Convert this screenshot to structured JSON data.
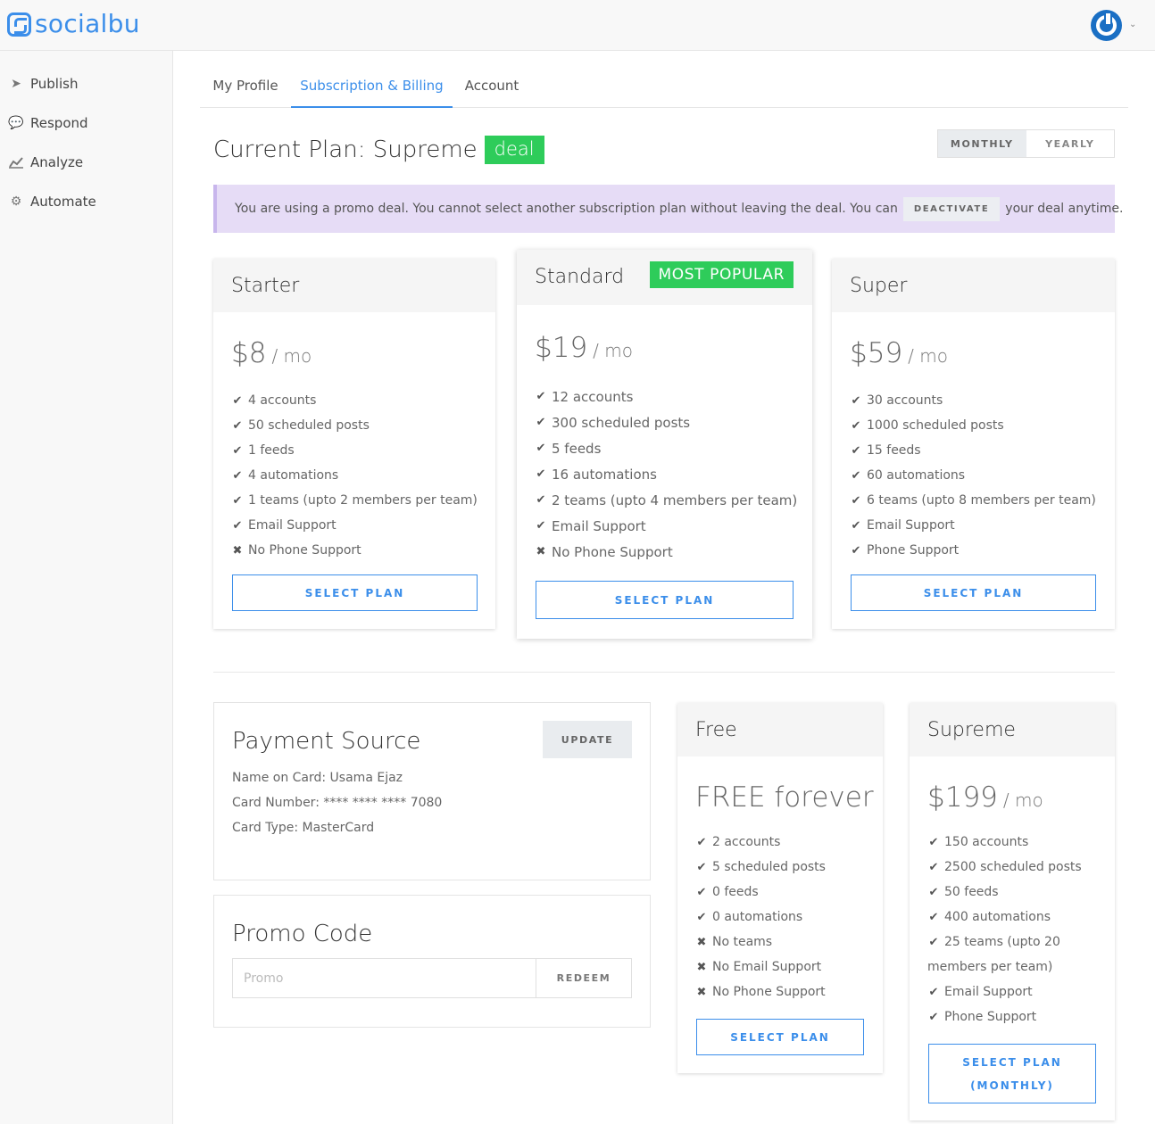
{
  "app": {
    "logo_text": "socialbu"
  },
  "sidebar": {
    "items": [
      {
        "label": "Publish",
        "icon": "paper-plane-icon"
      },
      {
        "label": "Respond",
        "icon": "comments-icon"
      },
      {
        "label": "Analyze",
        "icon": "line-chart-icon"
      },
      {
        "label": "Automate",
        "icon": "gears-icon"
      }
    ]
  },
  "tabs": [
    {
      "label": "My Profile"
    },
    {
      "label": "Subscription & Billing",
      "active": true
    },
    {
      "label": "Account"
    }
  ],
  "current_plan": {
    "label": "Current Plan: Supreme",
    "badge": "deal"
  },
  "billing_toggle": {
    "monthly": "MONTHLY",
    "yearly": "YEARLY",
    "selected": "MONTHLY"
  },
  "alert": {
    "text_before": "You are using a promo deal. You cannot select another subscription plan without leaving the deal. You can",
    "button": "DEACTIVATE",
    "text_after": "your deal anytime."
  },
  "plans": {
    "starter": {
      "name": "Starter",
      "price": "$8",
      "period": "/ mo",
      "features": [
        {
          "text": "4 accounts",
          "included": true
        },
        {
          "text": "50 scheduled posts",
          "included": true
        },
        {
          "text": "1 feeds",
          "included": true
        },
        {
          "text": "4 automations",
          "included": true
        },
        {
          "text": "1 teams (upto 2 members per team)",
          "included": true
        },
        {
          "text": "Email Support",
          "included": true
        },
        {
          "text": "No Phone Support",
          "included": false
        }
      ],
      "button": "SELECT PLAN"
    },
    "standard": {
      "name": "Standard",
      "badge": "MOST POPULAR",
      "price": "$19",
      "period": "/ mo",
      "features": [
        {
          "text": "12 accounts",
          "included": true
        },
        {
          "text": "300 scheduled posts",
          "included": true
        },
        {
          "text": "5 feeds",
          "included": true
        },
        {
          "text": "16 automations",
          "included": true
        },
        {
          "text": "2 teams (upto 4 members per team)",
          "included": true
        },
        {
          "text": "Email Support",
          "included": true
        },
        {
          "text": "No Phone Support",
          "included": false
        }
      ],
      "button": "SELECT PLAN"
    },
    "super": {
      "name": "Super",
      "price": "$59",
      "period": "/ mo",
      "features": [
        {
          "text": "30 accounts",
          "included": true
        },
        {
          "text": "1000 scheduled posts",
          "included": true
        },
        {
          "text": "15 feeds",
          "included": true
        },
        {
          "text": "60 automations",
          "included": true
        },
        {
          "text": "6 teams (upto 8 members per team)",
          "included": true
        },
        {
          "text": "Email Support",
          "included": true
        },
        {
          "text": "Phone Support",
          "included": true
        }
      ],
      "button": "SELECT PLAN"
    },
    "free": {
      "name": "Free",
      "price": "FREE forever",
      "features": [
        {
          "text": "2 accounts",
          "included": true
        },
        {
          "text": "5 scheduled posts",
          "included": true
        },
        {
          "text": "0 feeds",
          "included": true
        },
        {
          "text": "0 automations",
          "included": true
        },
        {
          "text": "No teams",
          "included": false
        },
        {
          "text": "No Email Support",
          "included": false
        },
        {
          "text": "No Phone Support",
          "included": false
        }
      ],
      "button": "SELECT PLAN"
    },
    "supreme": {
      "name": "Supreme",
      "price": "$199",
      "period": "/ mo",
      "features": [
        {
          "text": "150 accounts",
          "included": true
        },
        {
          "text": "2500 scheduled posts",
          "included": true
        },
        {
          "text": "50 feeds",
          "included": true
        },
        {
          "text": "400 automations",
          "included": true
        },
        {
          "text": "25 teams (upto 20",
          "included": true
        },
        {
          "text": "members per team)",
          "included": null
        },
        {
          "text": "Email Support",
          "included": true
        },
        {
          "text": "Phone Support",
          "included": true
        }
      ],
      "button_line1": "SELECT PLAN",
      "button_line2": "(MONTHLY)"
    }
  },
  "payment_source": {
    "title": "Payment Source",
    "update_button": "UPDATE",
    "name_on_card": "Name on Card: Usama Ejaz",
    "card_number": "Card Number: **** **** **** 7080",
    "card_type": "Card Type: MasterCard"
  },
  "promo_code": {
    "title": "Promo Code",
    "placeholder": "Promo",
    "value": "",
    "button": "REDEEM"
  },
  "colors": {
    "accent": "#3b8eea",
    "badge_green": "#2ecc5a",
    "alert_bg": "#e6dcf6"
  }
}
